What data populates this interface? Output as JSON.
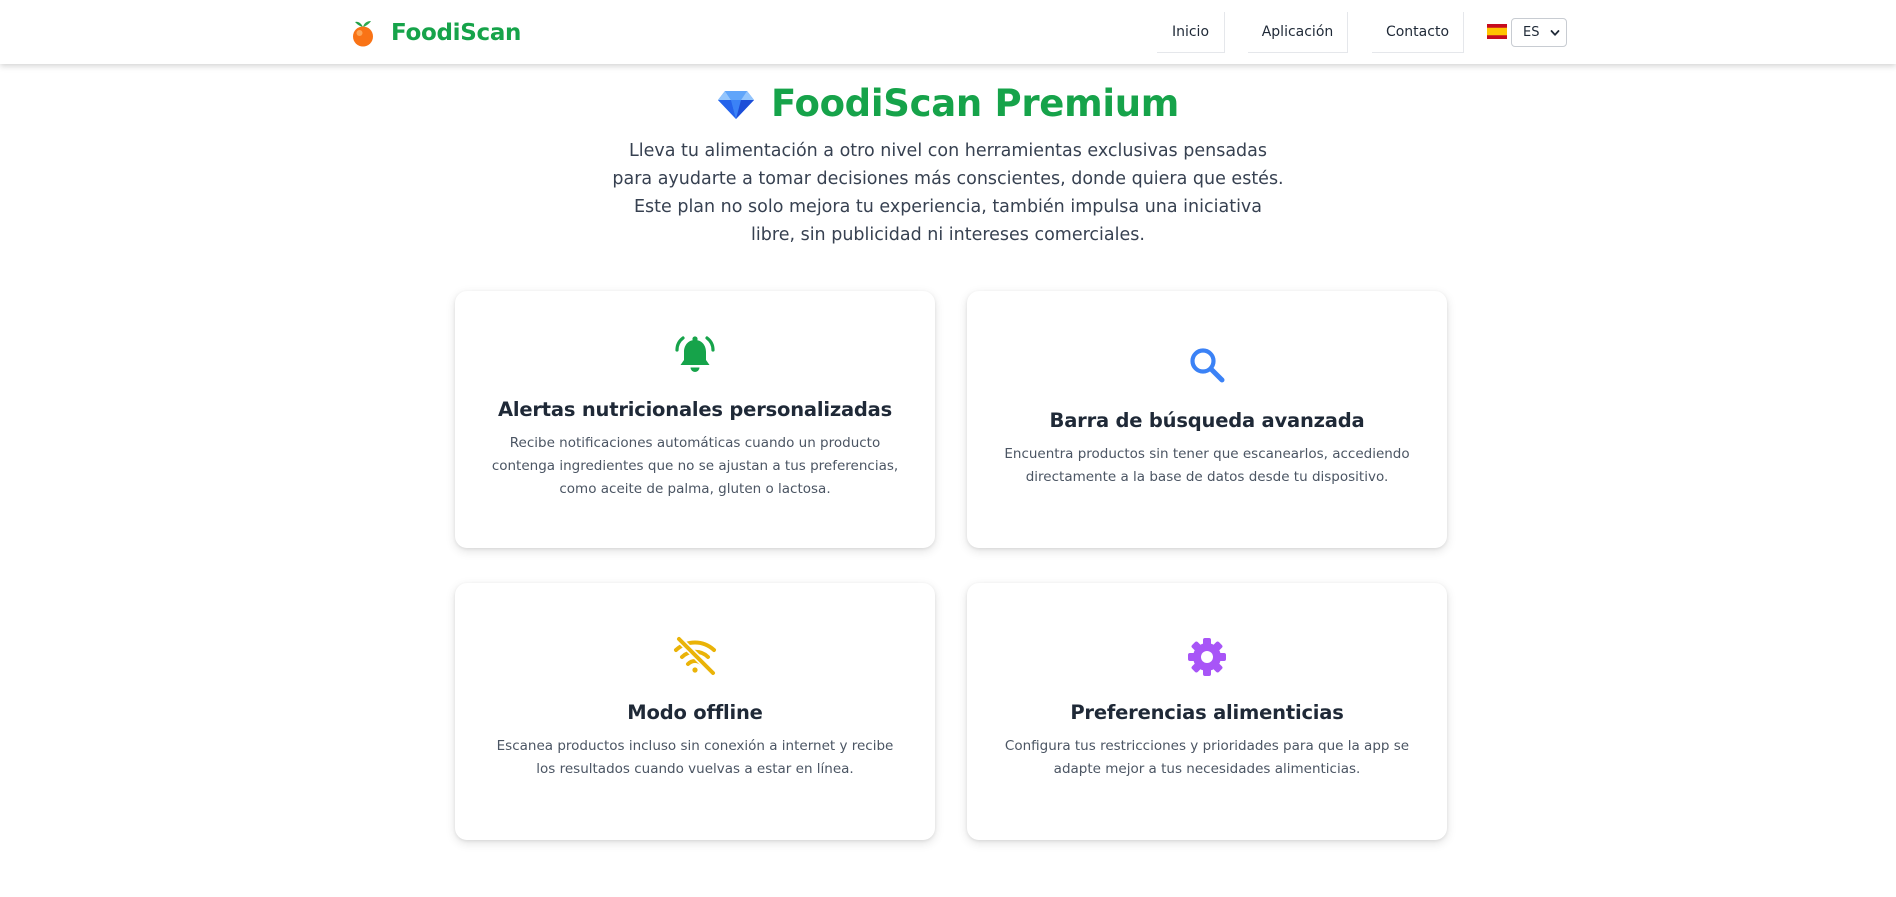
{
  "navbar": {
    "brand": "FoodiScan",
    "links": [
      "Inicio",
      "Aplicación",
      "Contacto"
    ],
    "language": "ES"
  },
  "hero": {
    "title": "FoodiScan Premium",
    "description": "Lleva tu alimentación a otro nivel con herramientas exclusivas pensadas para ayudarte a tomar decisiones más conscientes, donde quiera que estés. Este plan no solo mejora tu experiencia, también impulsa una iniciativa libre, sin publicidad ni intereses comerciales."
  },
  "features": [
    {
      "icon": "bell-ringing-icon",
      "icon_color": "#16a34a",
      "title": "Alertas nutricionales personalizadas",
      "description": "Recibe notificaciones automáticas cuando un producto contenga ingredientes que no se ajustan a tus preferencias, como aceite de palma, gluten o lactosa."
    },
    {
      "icon": "search-icon",
      "icon_color": "#3b82f6",
      "title": "Barra de búsqueda avanzada",
      "description": "Encuentra productos sin tener que escanearlos, accediendo directamente a la base de datos desde tu dispositivo."
    },
    {
      "icon": "wifi-off-icon",
      "icon_color": "#eab308",
      "title": "Modo offline",
      "description": "Escanea productos incluso sin conexión a internet y recibe los resultados cuando vuelvas a estar en línea."
    },
    {
      "icon": "gear-icon",
      "icon_color": "#a855f7",
      "title": "Preferencias alimenticias",
      "description": "Configura tus restricciones y prioridades para que la app se adapte mejor a tus necesidades alimenticias."
    }
  ],
  "colors": {
    "brand": "#16a34a",
    "text": "#1f2937",
    "muted": "#4b5563"
  }
}
